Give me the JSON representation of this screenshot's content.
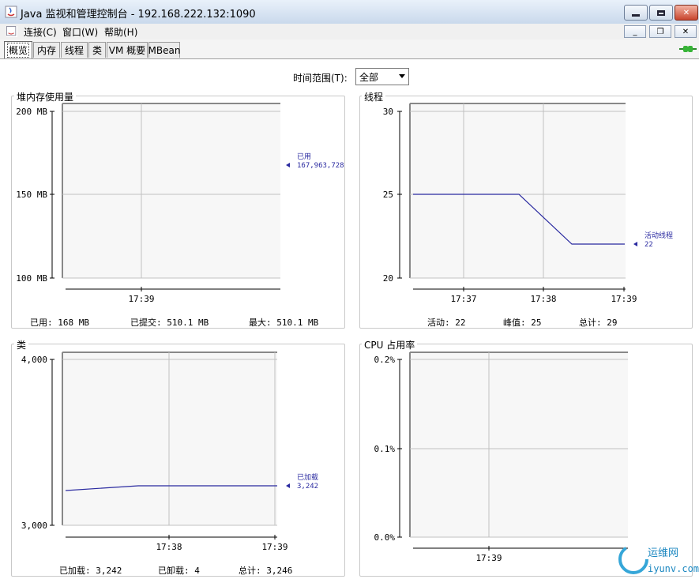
{
  "window": {
    "title": "Java 监视和管理控制台 - 192.168.222.132:1090"
  },
  "menu": {
    "connect": "连接(C)",
    "window": "窗口(W)",
    "help": "帮助(H)"
  },
  "tabs": [
    {
      "label": "概览",
      "active": true
    },
    {
      "label": "内存"
    },
    {
      "label": "线程"
    },
    {
      "label": "类"
    },
    {
      "label": "VM 概要"
    },
    {
      "label": "MBean"
    }
  ],
  "time_range": {
    "label": "时间范围(T):",
    "value": "全部"
  },
  "panels": {
    "heap": {
      "title": "堆内存使用量",
      "legend_name": "已用",
      "legend_value": "167,963,728",
      "used": "已用: 168 MB",
      "committed": "已提交: 510.1 MB",
      "max": "最大: 510.1 MB"
    },
    "threads": {
      "title": "线程",
      "legend_name": "活动线程",
      "legend_value": "22",
      "live": "活动: 22",
      "peak": "峰值: 25",
      "total": "总计: 29"
    },
    "classes": {
      "title": "类",
      "legend_name": "已加载",
      "legend_value": "3,242",
      "loaded": "已加载: 3,242",
      "unloaded": "已卸载: 4",
      "total": "总计: 3,246"
    },
    "cpu": {
      "title": "CPU 占用率"
    }
  },
  "chart_data": [
    {
      "type": "line",
      "title": "堆内存使用量",
      "yticks": [
        "100 MB",
        "150 MB",
        "200 MB"
      ],
      "ylim": [
        100,
        200
      ],
      "xticks": [
        "17:39"
      ],
      "series": []
    },
    {
      "type": "line",
      "title": "线程",
      "yticks": [
        "20",
        "25",
        "30"
      ],
      "ylim": [
        20,
        30
      ],
      "xticks": [
        "17:37",
        "17:38",
        "17:39"
      ],
      "series": [
        {
          "name": "活动线程",
          "x": [
            "17:36:40",
            "17:37:20",
            "17:37:40",
            "17:38:20",
            "17:38:40"
          ],
          "values": [
            25,
            25,
            25,
            22,
            22
          ]
        }
      ]
    },
    {
      "type": "line",
      "title": "类",
      "yticks": [
        "3,000",
        "4,000"
      ],
      "ylim": [
        3000,
        4000
      ],
      "xticks": [
        "17:38",
        "17:39"
      ],
      "series": [
        {
          "name": "已加载",
          "values": [
            3210,
            3242,
            3242,
            3242
          ]
        }
      ]
    },
    {
      "type": "line",
      "title": "CPU 占用率",
      "yticks": [
        "0.0%",
        "0.1%",
        "0.2%"
      ],
      "ylim": [
        0,
        0.2
      ],
      "xticks": [
        "17:39"
      ],
      "series": []
    }
  ],
  "colors": {
    "series": "#2a2aa0",
    "grid": "#c0c0c0",
    "plot_bg": "#f7f7f7",
    "tab_active": "#ffffff"
  }
}
